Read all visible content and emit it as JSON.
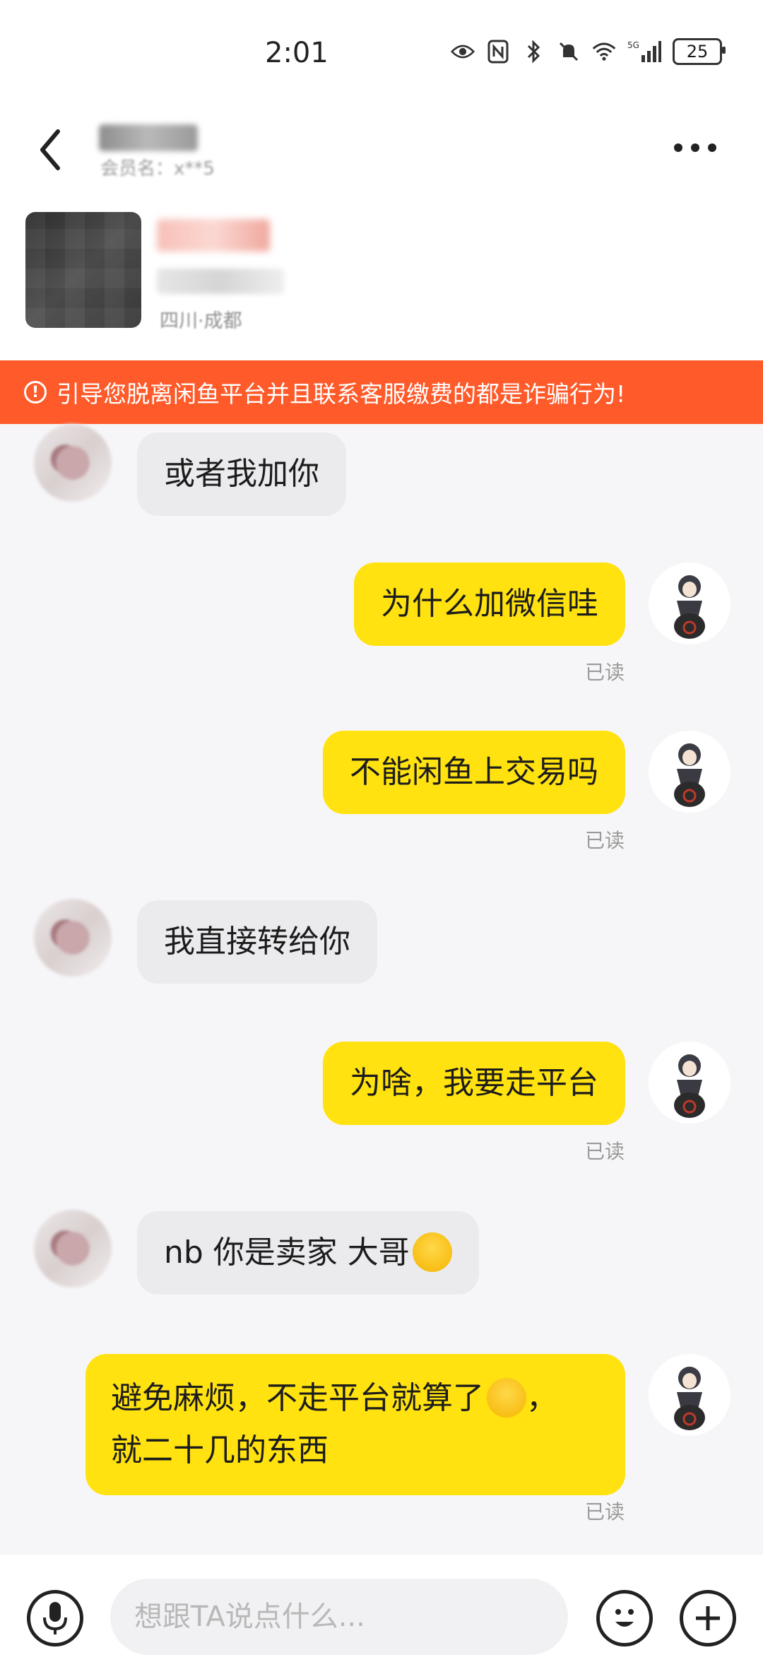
{
  "status_bar": {
    "time": "2:01",
    "network": "5G",
    "battery": "25"
  },
  "header": {
    "contact_name": "",
    "contact_sub": "会员名：x**5"
  },
  "product": {
    "location": "四川·成都"
  },
  "warning": {
    "text": "引导您脱离闲鱼平台并且联系客服缴费的都是诈骗行为!"
  },
  "messages": [
    {
      "from": "other",
      "text": "或者我加你"
    },
    {
      "from": "me",
      "text": "为什么加微信哇",
      "status": "已读"
    },
    {
      "from": "me",
      "text": "不能闲鱼上交易吗",
      "status": "已读"
    },
    {
      "from": "other",
      "text": "我直接转给你"
    },
    {
      "from": "me",
      "text": "为啥，我要走平台",
      "status": "已读"
    },
    {
      "from": "other",
      "text": "nb 你是卖家 大哥",
      "emoji": "crying-laughing-emoji"
    },
    {
      "from": "me",
      "line1": "避免麻烦，不走平台就算了",
      "line1_suffix": "，",
      "line2": "就二十几的东西",
      "emoji": "smiling-emoji",
      "status": "已读"
    }
  ],
  "input": {
    "placeholder": "想跟TA说点什么..."
  },
  "colors": {
    "warning_bg": "#ff5a2a",
    "my_bubble": "#ffe20f",
    "other_bubble": "#ebebee"
  }
}
